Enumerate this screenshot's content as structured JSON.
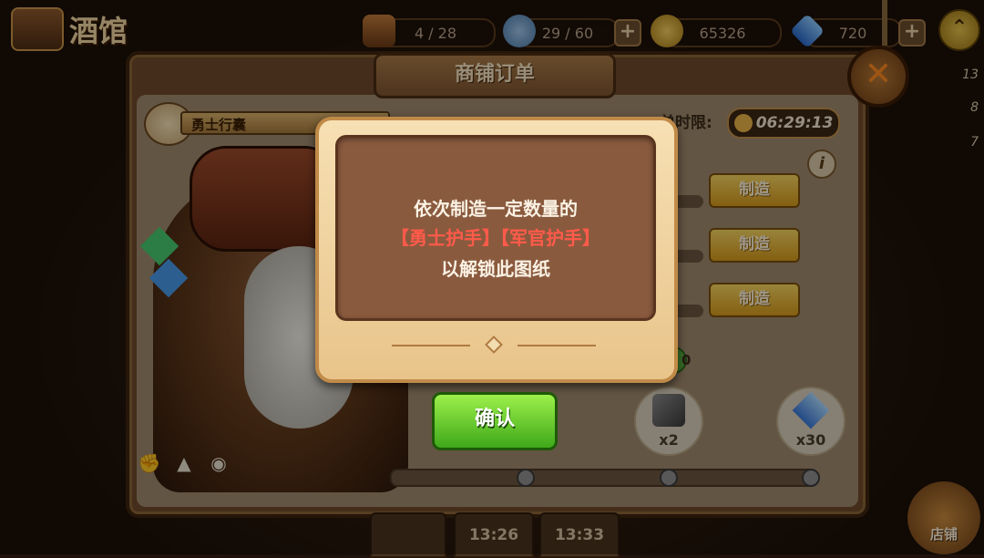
{
  "tavern": {
    "title": "酒馆"
  },
  "resources": [
    {
      "name": "chest",
      "value": "4 / 28"
    },
    {
      "name": "thumb",
      "value": "29 / 60"
    },
    {
      "name": "coin",
      "value": "65326"
    },
    {
      "name": "diamond",
      "value": "720"
    }
  ],
  "side_counts": [
    "13",
    "8",
    "7"
  ],
  "panel": {
    "title": "商铺订单"
  },
  "order": {
    "name": "勇士行囊",
    "timer_label": "单时限:",
    "timer": "06:29:13"
  },
  "make_buttons": [
    "制造",
    "制造",
    "制造"
  ],
  "rewards": {
    "xp": "0",
    "items": [
      {
        "icon": "hammer-icon",
        "count": "x2"
      },
      {
        "icon": "diamond-icon",
        "count": "x30"
      }
    ]
  },
  "bottom_tabs": [
    "13:26",
    "13:33"
  ],
  "shop": {
    "label": "店铺"
  },
  "modal": {
    "line1": "依次制造一定数量的",
    "item1": "【勇士护手】",
    "item2": "【军官护手】",
    "line3": "以解锁此图纸",
    "confirm": "确认"
  },
  "colors": {
    "highlight": "#ff5a4a",
    "confirm": "#5ec42a",
    "make": "#f0c040"
  }
}
